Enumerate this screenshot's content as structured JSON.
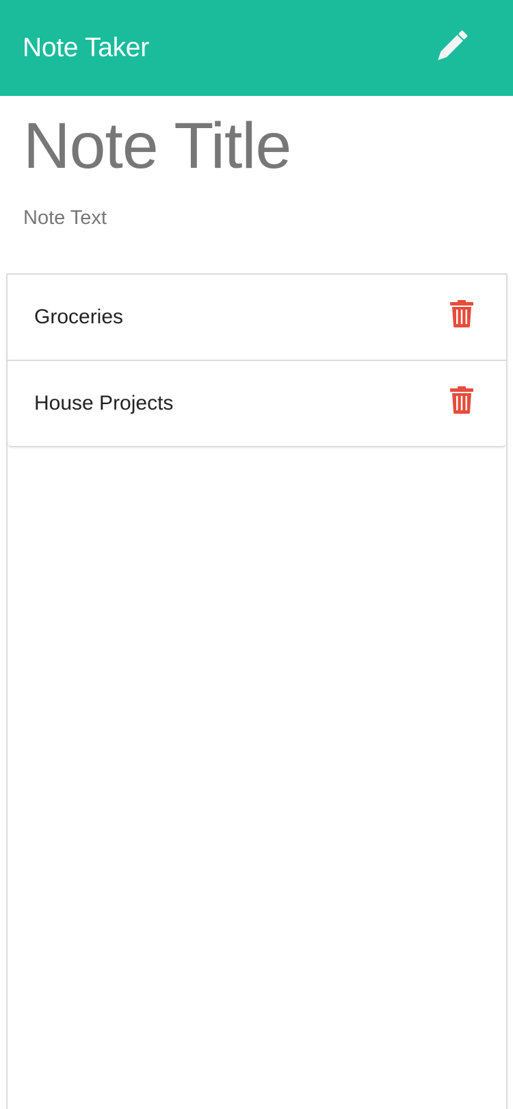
{
  "app": {
    "title": "Note Taker",
    "accent_color": "#1abc9c",
    "new_note_icon": "pencil-icon"
  },
  "editor": {
    "title_placeholder": "Note Title",
    "text_placeholder": "Note Text"
  },
  "notes": [
    {
      "title": "Groceries",
      "delete_icon": "trash-icon",
      "delete_color": "#e74c3c"
    },
    {
      "title": "House Projects",
      "delete_icon": "trash-icon",
      "delete_color": "#e74c3c"
    }
  ]
}
